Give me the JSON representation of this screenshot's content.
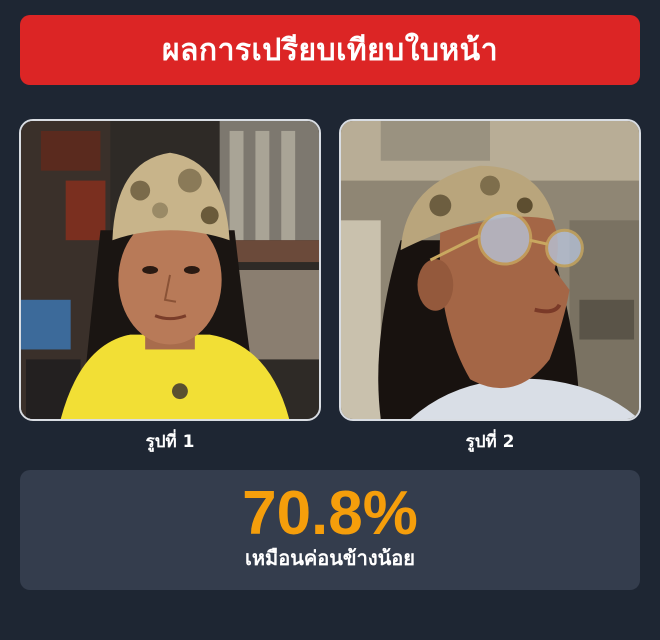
{
  "header": {
    "title": "ผลการเปรียบเทียบใบหน้า"
  },
  "photos": [
    {
      "caption": "รูปที่ 1"
    },
    {
      "caption": "รูปที่ 2"
    }
  ],
  "result": {
    "score": "70.8%",
    "verdict": "เหมือนค่อนข้างน้อย",
    "score_color": "#f59e0b"
  },
  "colors": {
    "background": "#1e2633",
    "header": "#dc2525",
    "card": "#343d4d"
  }
}
